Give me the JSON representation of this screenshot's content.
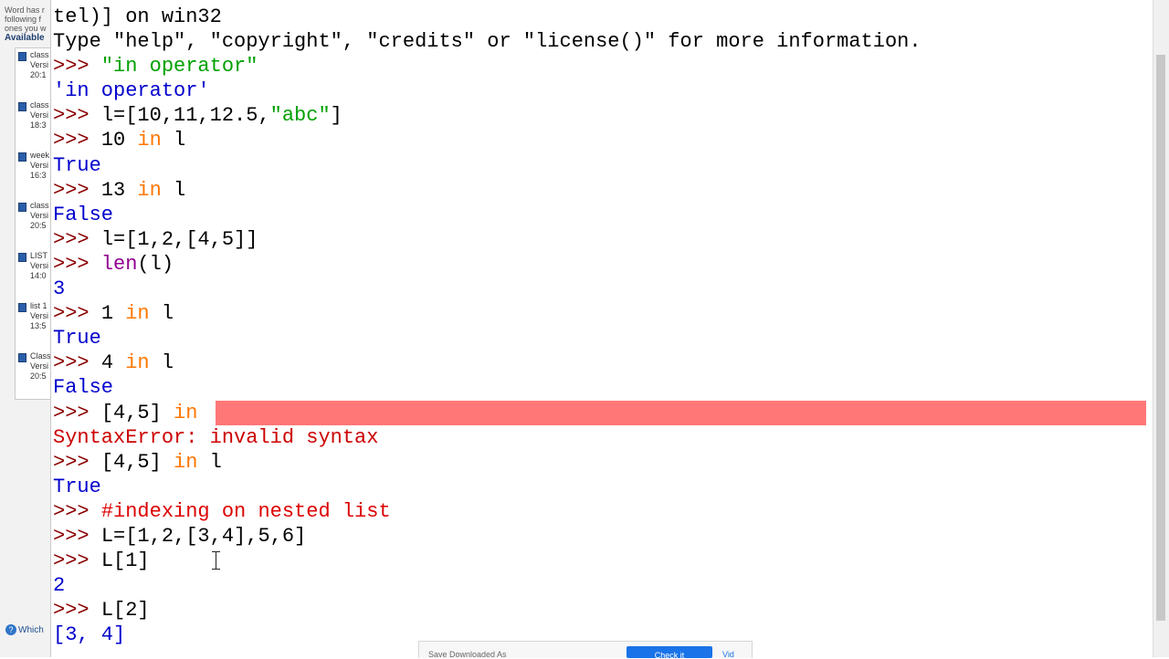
{
  "sidebar": {
    "note_lines": [
      "Word has r",
      "following f",
      "ones you w"
    ],
    "available_label": "Available",
    "files": [
      {
        "name": "class",
        "line2": "Versi",
        "line3": "20:1"
      },
      {
        "name": "class",
        "line2": "Versi",
        "line3": "18:3"
      },
      {
        "name": "week",
        "line2": "Versi",
        "line3": "16:3"
      },
      {
        "name": "class",
        "line2": "Versi",
        "line3": "20:5"
      },
      {
        "name": "LIST",
        "line2": "Versi",
        "line3": "14:0"
      },
      {
        "name": "list 1",
        "line2": "Versi",
        "line3": "13:5"
      },
      {
        "name": "Class",
        "line2": "Versi",
        "line3": "20:5"
      }
    ],
    "help_link": "Which"
  },
  "shell": {
    "lines": [
      {
        "segments": [
          {
            "text": "tel)] on win32",
            "style": "code"
          }
        ]
      },
      {
        "segments": [
          {
            "text": "Type \"help\", \"copyright\", \"credits\" or \"license()\" for more information.",
            "style": "code"
          }
        ]
      },
      {
        "segments": [
          {
            "text": ">>> ",
            "style": "prompt"
          },
          {
            "text": "\"in operator\"",
            "style": "str"
          }
        ]
      },
      {
        "segments": [
          {
            "text": "'in operator'",
            "style": "out"
          }
        ]
      },
      {
        "segments": [
          {
            "text": ">>> ",
            "style": "prompt"
          },
          {
            "text": "l=[10,11,12.5,",
            "style": "code"
          },
          {
            "text": "\"abc\"",
            "style": "str"
          },
          {
            "text": "]",
            "style": "code"
          }
        ]
      },
      {
        "segments": [
          {
            "text": ">>> ",
            "style": "prompt"
          },
          {
            "text": "10 ",
            "style": "code"
          },
          {
            "text": "in",
            "style": "kw"
          },
          {
            "text": " l",
            "style": "code"
          }
        ]
      },
      {
        "segments": [
          {
            "text": "True",
            "style": "out"
          }
        ]
      },
      {
        "segments": [
          {
            "text": ">>> ",
            "style": "prompt"
          },
          {
            "text": "13 ",
            "style": "code"
          },
          {
            "text": "in",
            "style": "kw"
          },
          {
            "text": " l",
            "style": "code"
          }
        ]
      },
      {
        "segments": [
          {
            "text": "False",
            "style": "out"
          }
        ]
      },
      {
        "segments": [
          {
            "text": ">>> ",
            "style": "prompt"
          },
          {
            "text": "l=[1,2,[4,5]]",
            "style": "code"
          }
        ]
      },
      {
        "segments": [
          {
            "text": ">>> ",
            "style": "prompt"
          },
          {
            "text": "len",
            "style": "builtin"
          },
          {
            "text": "(l)",
            "style": "code"
          }
        ]
      },
      {
        "segments": [
          {
            "text": "3",
            "style": "out"
          }
        ]
      },
      {
        "segments": [
          {
            "text": ">>> ",
            "style": "prompt"
          },
          {
            "text": "1 ",
            "style": "code"
          },
          {
            "text": "in",
            "style": "kw"
          },
          {
            "text": " l",
            "style": "code"
          }
        ]
      },
      {
        "segments": [
          {
            "text": "True",
            "style": "out"
          }
        ]
      },
      {
        "segments": [
          {
            "text": ">>> ",
            "style": "prompt"
          },
          {
            "text": "4 ",
            "style": "code"
          },
          {
            "text": "in",
            "style": "kw"
          },
          {
            "text": " l",
            "style": "code"
          }
        ]
      },
      {
        "segments": [
          {
            "text": "False",
            "style": "out"
          }
        ]
      },
      {
        "segments": [
          {
            "text": ">>> ",
            "style": "prompt"
          },
          {
            "text": "[4,5] ",
            "style": "code"
          },
          {
            "text": "in",
            "style": "kw"
          }
        ],
        "error_mark": true
      },
      {
        "segments": [
          {
            "text": "SyntaxError: invalid syntax",
            "style": "err"
          }
        ]
      },
      {
        "segments": [
          {
            "text": ">>> ",
            "style": "prompt"
          },
          {
            "text": "[4,5] ",
            "style": "code"
          },
          {
            "text": "in",
            "style": "kw"
          },
          {
            "text": " l",
            "style": "code"
          }
        ]
      },
      {
        "segments": [
          {
            "text": "True",
            "style": "out"
          }
        ]
      },
      {
        "segments": [
          {
            "text": ">>> ",
            "style": "prompt"
          },
          {
            "text": "#indexing on nested list",
            "style": "comment"
          }
        ]
      },
      {
        "segments": [
          {
            "text": ">>> ",
            "style": "prompt"
          },
          {
            "text": "L=[1,2,[3,4],5,6]",
            "style": "code"
          }
        ]
      },
      {
        "segments": [
          {
            "text": ">>> ",
            "style": "prompt"
          },
          {
            "text": "L[1]",
            "style": "code"
          }
        ]
      },
      {
        "segments": [
          {
            "text": "2",
            "style": "out"
          }
        ]
      },
      {
        "segments": [
          {
            "text": ">>> ",
            "style": "prompt"
          },
          {
            "text": "L[2]",
            "style": "code"
          }
        ]
      },
      {
        "segments": [
          {
            "text": "[3, 4]",
            "style": "out"
          }
        ]
      }
    ]
  },
  "popup": {
    "message": "Save Downloaded As",
    "button_label": "Check it",
    "link_label": "Vid"
  },
  "colors": {
    "prompt": "#8b0000",
    "string": "#00a000",
    "keyword": "#ff7700",
    "builtin": "#900090",
    "output": "#0000cc",
    "error": "#cc0000",
    "error_highlight": "#ff7777"
  }
}
